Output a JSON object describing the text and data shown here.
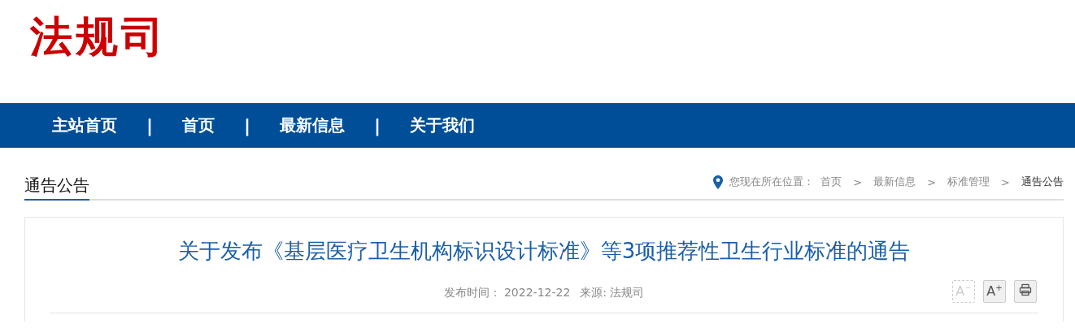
{
  "logo": {
    "text": "法规司"
  },
  "nav": [
    {
      "kind": "link",
      "label": "主站首页"
    },
    {
      "kind": "separator",
      "label": "|"
    },
    {
      "kind": "link",
      "label": "首页"
    },
    {
      "kind": "separator",
      "label": "|"
    },
    {
      "kind": "link",
      "label": "最新信息"
    },
    {
      "kind": "separator",
      "label": "|"
    },
    {
      "kind": "link",
      "label": "关于我们"
    }
  ],
  "section": {
    "title": "通告公告"
  },
  "breadcrumb": {
    "prefix": "您现在所在位置：",
    "items": [
      {
        "label": "首页",
        "current": false
      },
      {
        "label": "最新信息",
        "current": false
      },
      {
        "label": "标准管理",
        "current": false
      },
      {
        "label": "通告公告",
        "current": true
      }
    ],
    "separator": ">"
  },
  "article": {
    "title": "关于发布《基层医疗卫生机构标识设计标准》等3项推荐性卫生行业标准的通告",
    "date_label": "发布时间：",
    "date": "2022-12-22",
    "source": "来源: 法规司",
    "font_controls": [
      {
        "label": "A",
        "sign": "−",
        "disabled": true
      },
      {
        "label": "A",
        "sign": "+",
        "disabled": false
      }
    ]
  }
}
